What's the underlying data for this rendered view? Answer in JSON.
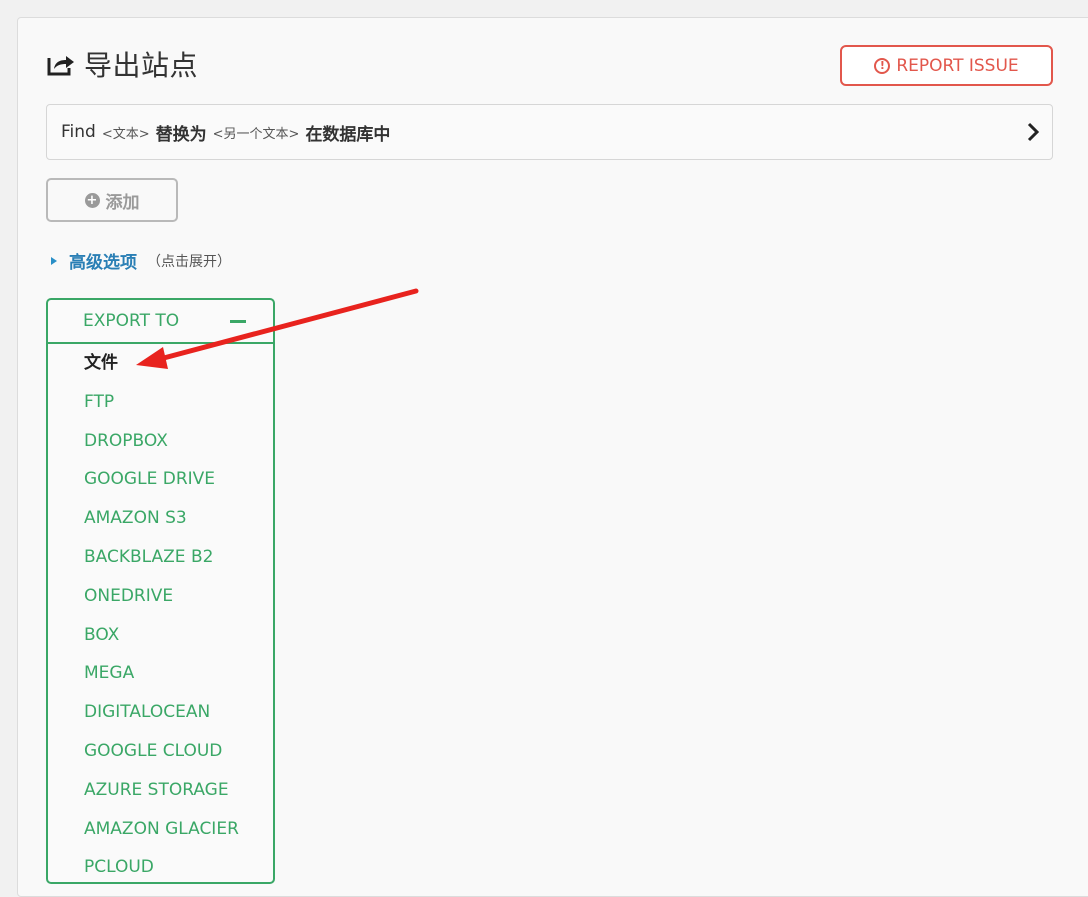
{
  "header": {
    "title": "导出站点",
    "title_icon": "export-share-icon",
    "report_label": "REPORT ISSUE",
    "report_icon": "exclamation-circle-icon"
  },
  "find_replace": {
    "find": "Find",
    "find_placeholder": "<文本>",
    "replace_with": "替换为",
    "replace_placeholder": "<另一个文本>",
    "in_database": "在数据库中",
    "chevron_icon": "chevron-right-icon"
  },
  "add_button": {
    "label": "添加",
    "icon": "plus-circle-icon"
  },
  "advanced": {
    "label": "高级选项",
    "hint": "（点击展开）"
  },
  "export": {
    "title": "EXPORT TO",
    "items": [
      "文件",
      "FTP",
      "DROPBOX",
      "GOOGLE DRIVE",
      "AMAZON S3",
      "BACKBLAZE B2",
      "ONEDRIVE",
      "BOX",
      "MEGA",
      "DIGITALOCEAN",
      "GOOGLE CLOUD",
      "AZURE STORAGE",
      "AMAZON GLACIER",
      "PCLOUD"
    ]
  },
  "colors": {
    "accent_green": "#3aa766",
    "report_red": "#e2574c",
    "link_blue": "#2a7fb5",
    "annotation_arrow": "#e8231e"
  }
}
